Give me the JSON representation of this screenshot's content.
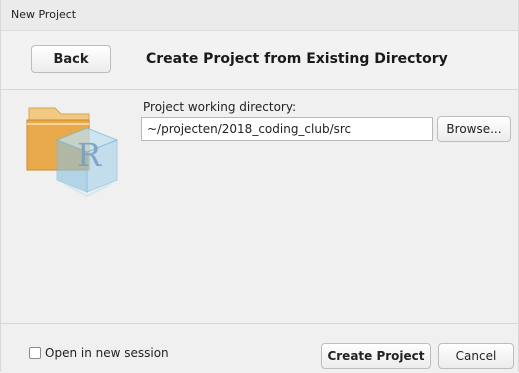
{
  "window": {
    "title": "New Project"
  },
  "header": {
    "back_label": "Back",
    "heading": "Create Project from Existing Directory"
  },
  "form": {
    "directory_label": "Project working directory:",
    "directory_value": "~/projecten/2018_coding_club/src",
    "browse_label": "Browse...",
    "icon_letter": "R"
  },
  "footer": {
    "new_session_label": "Open in new session",
    "new_session_checked": false,
    "create_label": "Create Project",
    "cancel_label": "Cancel"
  },
  "colors": {
    "folder": "#e7a94a",
    "cube": "#7fb7d8",
    "r_letter": "#7a9fbf"
  }
}
